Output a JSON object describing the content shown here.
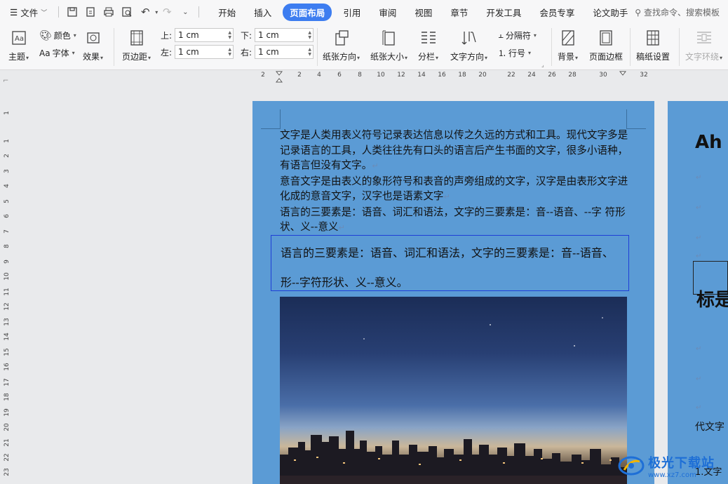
{
  "menubar": {
    "file_label": "文件",
    "tabs": [
      "开始",
      "插入",
      "页面布局",
      "引用",
      "审阅",
      "视图",
      "章节",
      "开发工具",
      "会员专享",
      "论文助手"
    ],
    "active_tab": "页面布局",
    "search_placeholder": "查找命令、搜索模板",
    "accent_color": "#3d7df0"
  },
  "ribbon": {
    "theme_label": "主题",
    "color_label": "颜色",
    "font_label": "字体",
    "effect_label": "效果",
    "margins_label": "页边距",
    "margin_top_label": "上:",
    "margin_top_value": "1 cm",
    "margin_bottom_label": "下:",
    "margin_bottom_value": "1 cm",
    "margin_left_label": "左:",
    "margin_left_value": "1 cm",
    "margin_right_label": "右:",
    "margin_right_value": "1 cm",
    "orientation_label": "纸张方向",
    "size_label": "纸张大小",
    "columns_label": "分栏",
    "text_direction_label": "文字方向",
    "breaks_label": "分隔符",
    "line_numbers_label": "行号",
    "background_label": "背景",
    "page_border_label": "页面边框",
    "manuscript_label": "稿纸设置",
    "text_wrap_label": "文字环绕"
  },
  "ruler": {
    "h_numbers": [
      "2",
      "2",
      "4",
      "6",
      "8",
      "10",
      "12",
      "14",
      "16",
      "18",
      "20",
      "22",
      "24",
      "26",
      "28",
      "30",
      "32"
    ],
    "v_numbers": [
      "1",
      "1",
      "2",
      "3",
      "4",
      "5",
      "6",
      "7",
      "8",
      "9",
      "10",
      "11",
      "12",
      "13",
      "14",
      "15",
      "16",
      "17",
      "18",
      "19",
      "20",
      "21",
      "22",
      "23"
    ]
  },
  "page1": {
    "background_color": "#5b9bd5",
    "para1": "文字是人类用表义符号记录表达信息以传之久远的方式和工具。现代文字多是记录语言的工具，人类往往先有口头的语言后产生书面的文字，很多小语种，有语言但没有文字。",
    "para2": "意音文字是由表义的象形符号和表音的声旁组成的文字，汉字是由表形文字进化成的意音文字，汉字也是语素文字",
    "para3": "语言的三要素是：语音、词汇和语法，文字的三要素是：音--语音、--字 符形状、义--意义",
    "textbox": "语言的三要素是：语音、词汇和语法，文字的三要素是：音--语音、形--字符形状、义--意义。",
    "textbox_border_color": "#1f3fd6"
  },
  "page2": {
    "heading1": "Ah",
    "heading2": "标是",
    "text": "代文字",
    "list_item": "1.文字"
  },
  "watermark": {
    "title": "极光下载站",
    "url": "www.xz7.com"
  }
}
